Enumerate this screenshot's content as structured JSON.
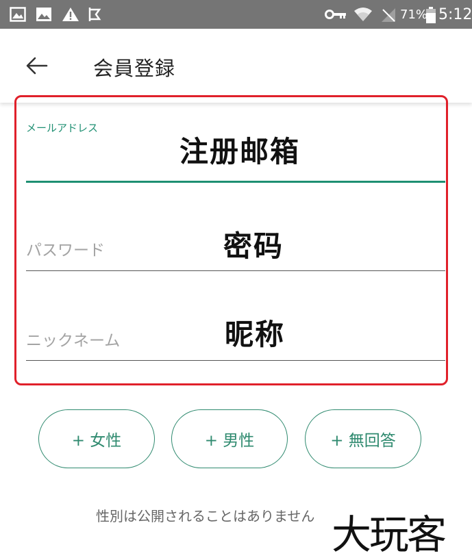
{
  "status_bar": {
    "left_icons": [
      "image-icon",
      "picture-icon",
      "warning-icon",
      "cast-icon"
    ],
    "right_icons": [
      "vpn-key-icon",
      "wifi-icon",
      "no-sim-icon",
      "battery-icon"
    ],
    "battery": "71%",
    "time": "5:12"
  },
  "app_bar": {
    "back_icon": "back-arrow-icon",
    "title": "会員登録"
  },
  "form": {
    "email": {
      "label": "メールアドレス",
      "annotation": "注册邮箱"
    },
    "password": {
      "label": "パスワード",
      "annotation": "密码"
    },
    "nickname": {
      "label": "ニックネーム",
      "annotation": "昵称"
    }
  },
  "gender": {
    "options": [
      "+ 女性",
      "+ 男性",
      "+ 無回答"
    ],
    "note": "性別は公開されることはありません"
  },
  "watermark": "大玩客",
  "colors": {
    "accent": "#1e8f72",
    "highlight_frame": "#e0202a",
    "status_bar": "#757575"
  }
}
